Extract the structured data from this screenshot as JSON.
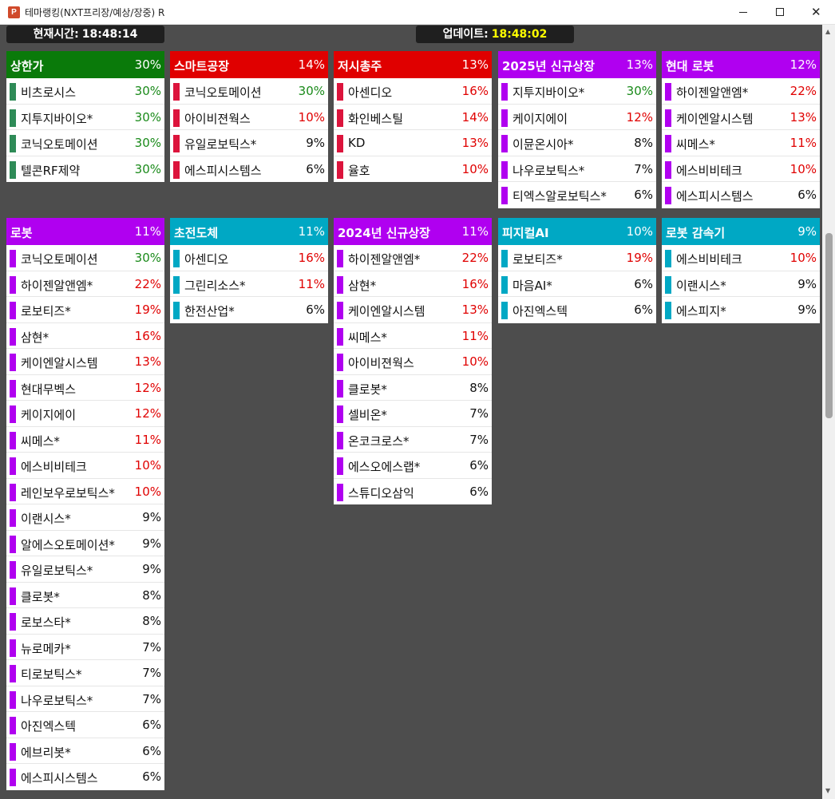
{
  "window": {
    "icon_letter": "P",
    "title": "테마랭킹(NXT프리장/예상/장중) R",
    "close_glyph": "✕"
  },
  "clock": {
    "current_label": "현재시간:",
    "current_value": "18:48:14",
    "update_label": "업데이트:",
    "update_value": "18:48:02"
  },
  "colors": {
    "green_header": "#0a7a0a",
    "red_header": "#e00000",
    "purple_header": "#b000f0",
    "teal_header": "#00a8c4",
    "green_bar": "#2e8b57",
    "red_bar": "#dc143c",
    "purple_bar": "#b000f0",
    "teal_bar": "#00a8c4",
    "up_limit_text": "#1a8a1a",
    "rise_text": "#e00000",
    "update_time_text": "#ffff00"
  },
  "panels": [
    {
      "title": "상한가",
      "pct": "30%",
      "theme": "green",
      "rows": [
        {
          "name": "비츠로시스",
          "pct": "30%",
          "level": "limit"
        },
        {
          "name": "지투지바이오*",
          "pct": "30%",
          "level": "limit"
        },
        {
          "name": "코닉오토메이션",
          "pct": "30%",
          "level": "limit"
        },
        {
          "name": "텔콘RF제약",
          "pct": "30%",
          "level": "limit"
        }
      ]
    },
    {
      "title": "스마트공장",
      "pct": "14%",
      "theme": "red",
      "rows": [
        {
          "name": "코닉오토메이션",
          "pct": "30%",
          "level": "limit"
        },
        {
          "name": "아이비젼웍스",
          "pct": "10%",
          "level": "rise"
        },
        {
          "name": "유일로보틱스*",
          "pct": "9%",
          "level": "normal"
        },
        {
          "name": "에스피시스템스",
          "pct": "6%",
          "level": "normal"
        }
      ]
    },
    {
      "title": "저시총주",
      "pct": "13%",
      "theme": "red",
      "rows": [
        {
          "name": "아센디오",
          "pct": "16%",
          "level": "rise"
        },
        {
          "name": "화인베스틸",
          "pct": "14%",
          "level": "rise"
        },
        {
          "name": "KD",
          "pct": "13%",
          "level": "rise"
        },
        {
          "name": "율호",
          "pct": "10%",
          "level": "rise"
        }
      ]
    },
    {
      "title": "2025년 신규상장",
      "pct": "13%",
      "theme": "purple",
      "rows": [
        {
          "name": "지투지바이오*",
          "pct": "30%",
          "level": "limit"
        },
        {
          "name": "케이지에이",
          "pct": "12%",
          "level": "rise"
        },
        {
          "name": "이뮨온시아*",
          "pct": "8%",
          "level": "normal"
        },
        {
          "name": "나우로보틱스*",
          "pct": "7%",
          "level": "normal"
        },
        {
          "name": "티엑스알로보틱스*",
          "pct": "6%",
          "level": "normal"
        }
      ]
    },
    {
      "title": "현대 로봇",
      "pct": "12%",
      "theme": "purple",
      "rows": [
        {
          "name": "하이젠알앤엠*",
          "pct": "22%",
          "level": "rise"
        },
        {
          "name": "케이엔알시스템",
          "pct": "13%",
          "level": "rise"
        },
        {
          "name": "씨메스*",
          "pct": "11%",
          "level": "rise"
        },
        {
          "name": "에스비비테크",
          "pct": "10%",
          "level": "rise"
        },
        {
          "name": "에스피시스템스",
          "pct": "6%",
          "level": "normal"
        }
      ]
    },
    {
      "title": "로봇",
      "pct": "11%",
      "theme": "purple",
      "rows": [
        {
          "name": "코닉오토메이션",
          "pct": "30%",
          "level": "limit"
        },
        {
          "name": "하이젠알앤엠*",
          "pct": "22%",
          "level": "rise"
        },
        {
          "name": "로보티즈*",
          "pct": "19%",
          "level": "rise"
        },
        {
          "name": "삼현*",
          "pct": "16%",
          "level": "rise"
        },
        {
          "name": "케이엔알시스템",
          "pct": "13%",
          "level": "rise"
        },
        {
          "name": "현대무벡스",
          "pct": "12%",
          "level": "rise"
        },
        {
          "name": "케이지에이",
          "pct": "12%",
          "level": "rise"
        },
        {
          "name": "씨메스*",
          "pct": "11%",
          "level": "rise"
        },
        {
          "name": "에스비비테크",
          "pct": "10%",
          "level": "rise"
        },
        {
          "name": "레인보우로보틱스*",
          "pct": "10%",
          "level": "rise"
        },
        {
          "name": "이랜시스*",
          "pct": "9%",
          "level": "normal"
        },
        {
          "name": "알에스오토메이션*",
          "pct": "9%",
          "level": "normal"
        },
        {
          "name": "유일로보틱스*",
          "pct": "9%",
          "level": "normal"
        },
        {
          "name": "클로봇*",
          "pct": "8%",
          "level": "normal"
        },
        {
          "name": "로보스타*",
          "pct": "8%",
          "level": "normal"
        },
        {
          "name": "뉴로메카*",
          "pct": "7%",
          "level": "normal"
        },
        {
          "name": "티로보틱스*",
          "pct": "7%",
          "level": "normal"
        },
        {
          "name": "나우로보틱스*",
          "pct": "7%",
          "level": "normal"
        },
        {
          "name": "아진엑스텍",
          "pct": "6%",
          "level": "normal"
        },
        {
          "name": "에브리봇*",
          "pct": "6%",
          "level": "normal"
        },
        {
          "name": "에스피시스템스",
          "pct": "6%",
          "level": "normal"
        }
      ]
    },
    {
      "title": "초전도체",
      "pct": "11%",
      "theme": "teal",
      "rows": [
        {
          "name": "아센디오",
          "pct": "16%",
          "level": "rise"
        },
        {
          "name": "그린리소스*",
          "pct": "11%",
          "level": "rise"
        },
        {
          "name": "한전산업*",
          "pct": "6%",
          "level": "normal"
        }
      ]
    },
    {
      "title": "2024년 신규상장",
      "pct": "11%",
      "theme": "purple",
      "rows": [
        {
          "name": "하이젠알앤엠*",
          "pct": "22%",
          "level": "rise"
        },
        {
          "name": "삼현*",
          "pct": "16%",
          "level": "rise"
        },
        {
          "name": "케이엔알시스템",
          "pct": "13%",
          "level": "rise"
        },
        {
          "name": "씨메스*",
          "pct": "11%",
          "level": "rise"
        },
        {
          "name": "아이비젼웍스",
          "pct": "10%",
          "level": "rise"
        },
        {
          "name": "클로봇*",
          "pct": "8%",
          "level": "normal"
        },
        {
          "name": "셀비온*",
          "pct": "7%",
          "level": "normal"
        },
        {
          "name": "온코크로스*",
          "pct": "7%",
          "level": "normal"
        },
        {
          "name": "에스오에스랩*",
          "pct": "6%",
          "level": "normal"
        },
        {
          "name": "스튜디오삼익",
          "pct": "6%",
          "level": "normal"
        }
      ]
    },
    {
      "title": "피지컬AI",
      "pct": "10%",
      "theme": "teal",
      "rows": [
        {
          "name": "로보티즈*",
          "pct": "19%",
          "level": "rise"
        },
        {
          "name": "마음AI*",
          "pct": "6%",
          "level": "normal"
        },
        {
          "name": "아진엑스텍",
          "pct": "6%",
          "level": "normal"
        }
      ]
    },
    {
      "title": "로봇 감속기",
      "pct": "9%",
      "theme": "teal",
      "rows": [
        {
          "name": "에스비비테크",
          "pct": "10%",
          "level": "rise"
        },
        {
          "name": "이랜시스*",
          "pct": "9%",
          "level": "normal"
        },
        {
          "name": "에스피지*",
          "pct": "9%",
          "level": "normal"
        }
      ]
    }
  ]
}
